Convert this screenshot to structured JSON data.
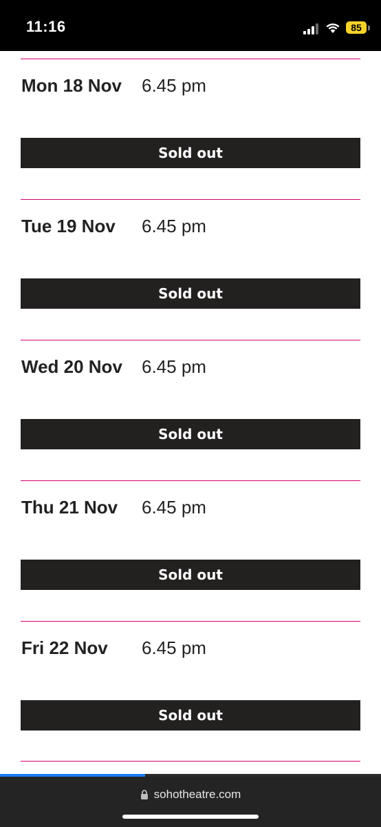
{
  "status_bar": {
    "time": "11:16",
    "battery": "85",
    "signal_icon": "cellular-signal-icon",
    "wifi_icon": "wifi-icon"
  },
  "performances": [
    {
      "date": "Mon 18 Nov",
      "time": "6.45 pm",
      "button": "Sold out"
    },
    {
      "date": "Tue 19 Nov",
      "time": "6.45 pm",
      "button": "Sold out"
    },
    {
      "date": "Wed 20 Nov",
      "time": "6.45 pm",
      "button": "Sold out"
    },
    {
      "date": "Thu 21 Nov",
      "time": "6.45 pm",
      "button": "Sold out"
    },
    {
      "date": "Fri 22 Nov",
      "time": "6.45 pm",
      "button": "Sold out"
    }
  ],
  "browser": {
    "url": "sohotheatre.com",
    "page_load_progress": 0.38
  },
  "colors": {
    "divider": "#d8006b",
    "button_bg": "#232020",
    "progress": "#1a7cf0",
    "battery": "#f5d22a"
  }
}
